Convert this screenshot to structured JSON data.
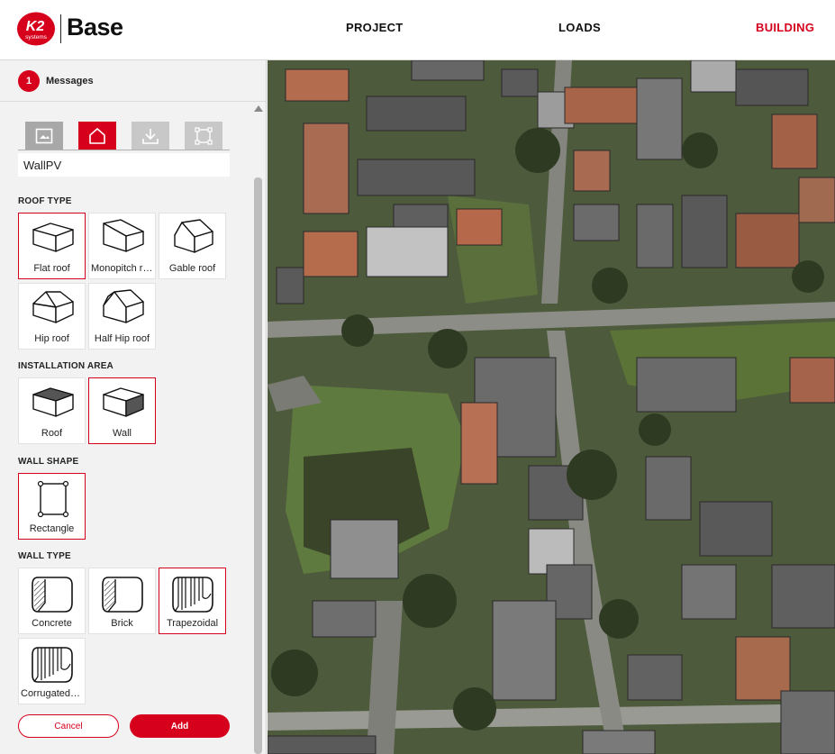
{
  "header": {
    "brand_line1": "K2",
    "brand_line2": "systems",
    "app_title": "Base",
    "nav": [
      {
        "label": "PROJECT"
      },
      {
        "label": "LOADS"
      },
      {
        "label": "BUILDING"
      }
    ],
    "accent_color": "#d6001c"
  },
  "messages": {
    "count": "1",
    "label": "Messages"
  },
  "tabs": [
    {
      "icon": "image-icon"
    },
    {
      "icon": "home-icon"
    },
    {
      "icon": "download-icon"
    },
    {
      "icon": "frame-corners-icon"
    }
  ],
  "building_name": {
    "value": "WallPV"
  },
  "roof_type": {
    "title": "ROOF TYPE",
    "options": [
      {
        "label": "Flat roof"
      },
      {
        "label": "Monopitch roof"
      },
      {
        "label": "Gable roof"
      },
      {
        "label": "Hip roof"
      },
      {
        "label": "Half Hip roof"
      }
    ]
  },
  "installation_area": {
    "title": "INSTALLATION AREA",
    "options": [
      {
        "label": "Roof"
      },
      {
        "label": "Wall"
      }
    ]
  },
  "wall_shape": {
    "title": "WALL SHAPE",
    "options": [
      {
        "label": "Rectangle"
      }
    ]
  },
  "wall_type": {
    "title": "WALL TYPE",
    "options": [
      {
        "label": "Concrete"
      },
      {
        "label": "Brick"
      },
      {
        "label": "Trapezoidal"
      },
      {
        "label": "Corrugated sheet"
      }
    ]
  },
  "actions": {
    "cancel_label": "Cancel",
    "add_label": "Add"
  }
}
